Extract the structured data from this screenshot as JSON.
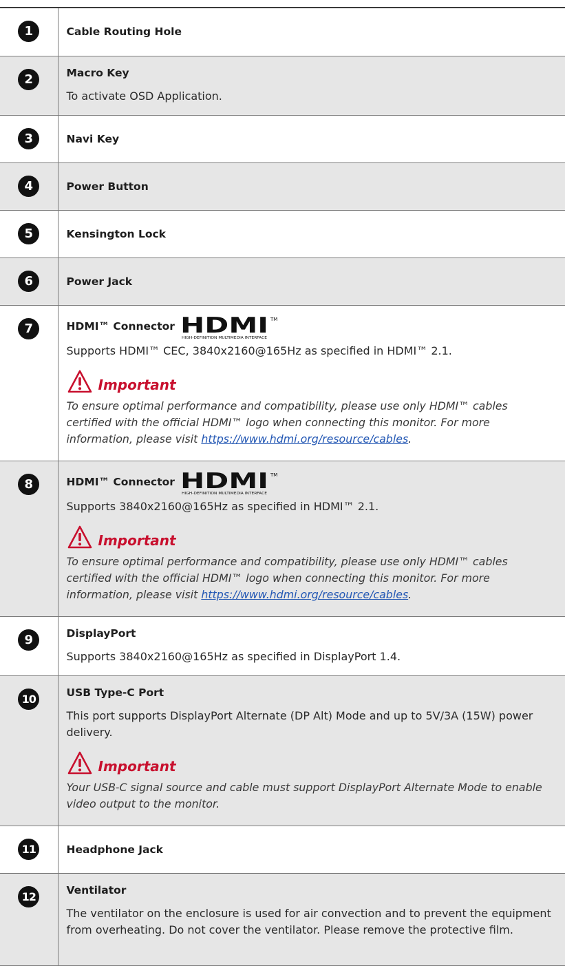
{
  "rows": [
    {
      "num": "1",
      "title": "Cable Routing Hole"
    },
    {
      "num": "2",
      "title": "Macro Key",
      "desc": "To activate OSD Application."
    },
    {
      "num": "3",
      "title": "Navi Key"
    },
    {
      "num": "4",
      "title": "Power Button"
    },
    {
      "num": "5",
      "title": "Kensington Lock"
    },
    {
      "num": "6",
      "title": "Power Jack"
    },
    {
      "num": "7",
      "title": "HDMI™ Connector",
      "desc": "Supports HDMI™ CEC, 3840x2160@165Hz as specified in HDMI™ 2.1.",
      "important": "Important",
      "note": "To ensure optimal performance and compatibility, please use only HDMI™ cables certified with the official HDMI™ logo when connecting this monitor. For more information, please visit ",
      "link": "https://www.hdmi.org/resource/cables",
      "note_end": "."
    },
    {
      "num": "8",
      "title": "HDMI™ Connector",
      "desc": "Supports 3840x2160@165Hz as specified in HDMI™ 2.1.",
      "important": "Important",
      "note": "To ensure optimal performance and compatibility, please use only HDMI™ cables certified with the official HDMI™ logo when connecting this monitor. For more information, please visit ",
      "link": "https://www.hdmi.org/resource/cables",
      "note_end": "."
    },
    {
      "num": "9",
      "title": "DisplayPort",
      "desc": "Supports 3840x2160@165Hz as specified in DisplayPort 1.4."
    },
    {
      "num": "10",
      "title": "USB Type-C Port",
      "desc": "This port supports DisplayPort Alternate (DP Alt) Mode and up to 5V/3A (15W) power delivery.",
      "important": "Important",
      "note": "Your USB-C signal source and cable must support DisplayPort Alternate Mode to enable video output to the monitor."
    },
    {
      "num": "11",
      "title": "Headphone Jack"
    },
    {
      "num": "12",
      "title": "Ventilator",
      "desc": "The ventilator on the enclosure is used for air convection and to prevent the equipment from overheating. Do not cover the ventilator. Please remove the protective film."
    }
  ],
  "hdmi_logo": {
    "wordmark": "HDMI",
    "tagline": "HIGH-DEFINITION MULTIMEDIA INTERFACE",
    "tm": "TM"
  },
  "colors": {
    "important_red": "#c8102e",
    "link_blue": "#2458b4",
    "row_shade": "#e6e6e6"
  }
}
